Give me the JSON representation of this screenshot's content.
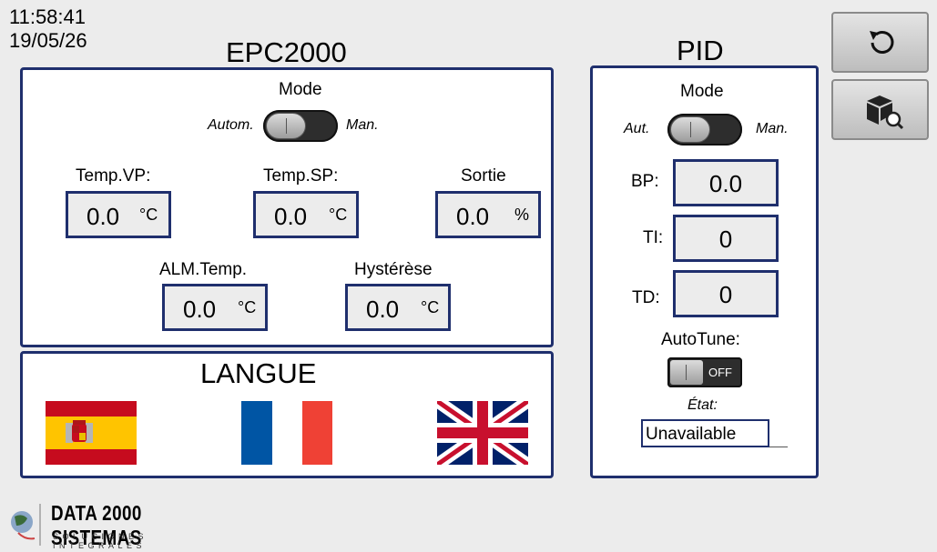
{
  "header": {
    "time": "11:58:41",
    "date": "19/05/26"
  },
  "epc": {
    "title": "EPC2000",
    "mode_label": "Mode",
    "mode_auto": "Autom.",
    "mode_man": "Man.",
    "fields": {
      "temp_vp": {
        "label": "Temp.VP:",
        "value": "0.0",
        "unit": "°C"
      },
      "temp_sp": {
        "label": "Temp.SP:",
        "value": "0.0",
        "unit": "°C"
      },
      "sortie": {
        "label": "Sortie",
        "value": "0.0",
        "unit": "%"
      },
      "alm_temp": {
        "label": "ALM.Temp.",
        "value": "0.0",
        "unit": "°C"
      },
      "hysterese": {
        "label": "Hystérèse",
        "value": "0.0",
        "unit": "°C"
      }
    }
  },
  "langue": {
    "title": "LANGUE",
    "flags": [
      "spain-flag-icon",
      "france-flag-icon",
      "uk-flag-icon"
    ]
  },
  "pid": {
    "title": "PID",
    "mode_label": "Mode",
    "mode_auto": "Aut.",
    "mode_man": "Man.",
    "bp": {
      "label": "BP:",
      "value": "0.0"
    },
    "ti": {
      "label": "TI:",
      "value": "0"
    },
    "td": {
      "label": "TD:",
      "value": "0"
    },
    "autotune_label": "AutoTune:",
    "autotune_toggle": "OFF",
    "etat_label": "État:",
    "etat_value": "Unavailable"
  },
  "buttons": {
    "refresh_icon": "refresh-icon",
    "package_search_icon": "package-search-icon"
  },
  "footer": {
    "brand": "DATA 2000 SISTEMAS",
    "tagline": "SOLUCIONES INTEGRALES"
  },
  "colors": {
    "panel_border": "#1f2f6d",
    "background": "#ececec"
  }
}
